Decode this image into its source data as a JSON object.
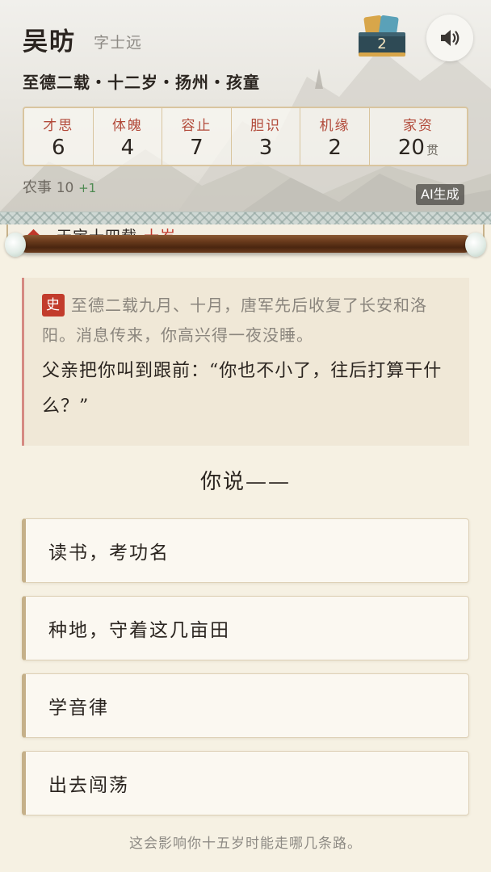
{
  "character": {
    "name": "吴昉",
    "courtesy_name": "字士远",
    "subtitle": "至德二载・十二岁・扬州・孩童"
  },
  "header_actions": {
    "cards_count": "2",
    "cards_icon": "cards-icon",
    "sound_icon": "speaker-icon"
  },
  "stats": [
    {
      "label": "才思",
      "value": "6"
    },
    {
      "label": "体魄",
      "value": "4"
    },
    {
      "label": "容止",
      "value": "7"
    },
    {
      "label": "胆识",
      "value": "3"
    },
    {
      "label": "机缘",
      "value": "2"
    },
    {
      "label": "家资",
      "value": "20",
      "unit": "贯"
    }
  ],
  "skill": {
    "label": "农事",
    "value": "10",
    "delta": "+1"
  },
  "ai_badge": "AI生成",
  "timeline": {
    "label": "天宝十四载",
    "age": "十岁"
  },
  "story": {
    "tag": "史",
    "history": "至德二载九月、十月，唐军先后收复了长安和洛阳。消息传来，你高兴得一夜没睡。",
    "dialogue": "父亲把你叫到跟前：“你也不小了，往后打算干什么？”"
  },
  "prompt": "你说——",
  "choices": [
    {
      "label": "读书，考功名"
    },
    {
      "label": "种地，守着这几亩田"
    },
    {
      "label": "学音律"
    },
    {
      "label": "出去闯荡"
    }
  ],
  "footnote": "这会影响你十五岁时能走哪几条路。",
  "colors": {
    "accent_red": "#c23c2c",
    "stat_label": "#b24a3a",
    "border_gold": "#d9c59f",
    "rod_brown": "#6a3b1c",
    "delta_green": "#4e8a52"
  }
}
